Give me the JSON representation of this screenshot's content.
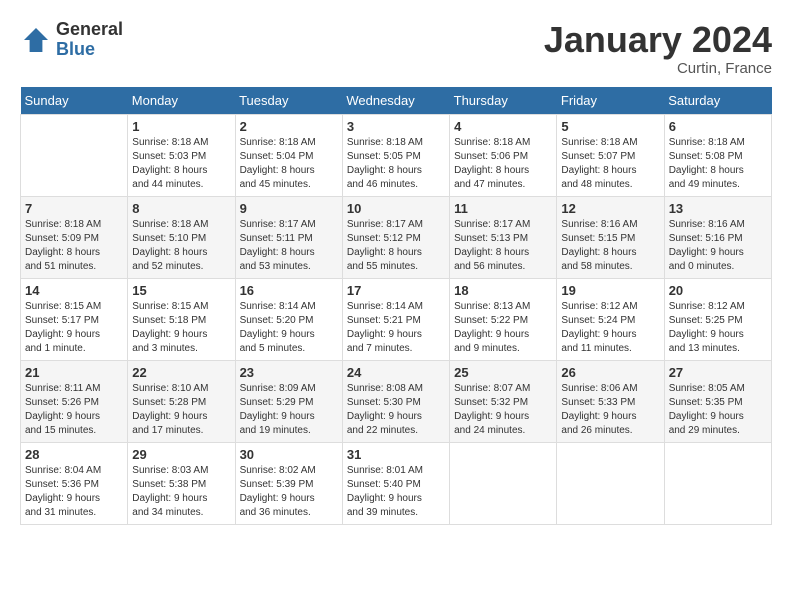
{
  "header": {
    "logo_general": "General",
    "logo_blue": "Blue",
    "month_title": "January 2024",
    "location": "Curtin, France"
  },
  "calendar": {
    "days_of_week": [
      "Sunday",
      "Monday",
      "Tuesday",
      "Wednesday",
      "Thursday",
      "Friday",
      "Saturday"
    ],
    "weeks": [
      [
        {
          "day": "",
          "info": ""
        },
        {
          "day": "1",
          "info": "Sunrise: 8:18 AM\nSunset: 5:03 PM\nDaylight: 8 hours\nand 44 minutes."
        },
        {
          "day": "2",
          "info": "Sunrise: 8:18 AM\nSunset: 5:04 PM\nDaylight: 8 hours\nand 45 minutes."
        },
        {
          "day": "3",
          "info": "Sunrise: 8:18 AM\nSunset: 5:05 PM\nDaylight: 8 hours\nand 46 minutes."
        },
        {
          "day": "4",
          "info": "Sunrise: 8:18 AM\nSunset: 5:06 PM\nDaylight: 8 hours\nand 47 minutes."
        },
        {
          "day": "5",
          "info": "Sunrise: 8:18 AM\nSunset: 5:07 PM\nDaylight: 8 hours\nand 48 minutes."
        },
        {
          "day": "6",
          "info": "Sunrise: 8:18 AM\nSunset: 5:08 PM\nDaylight: 8 hours\nand 49 minutes."
        }
      ],
      [
        {
          "day": "7",
          "info": "Sunrise: 8:18 AM\nSunset: 5:09 PM\nDaylight: 8 hours\nand 51 minutes."
        },
        {
          "day": "8",
          "info": "Sunrise: 8:18 AM\nSunset: 5:10 PM\nDaylight: 8 hours\nand 52 minutes."
        },
        {
          "day": "9",
          "info": "Sunrise: 8:17 AM\nSunset: 5:11 PM\nDaylight: 8 hours\nand 53 minutes."
        },
        {
          "day": "10",
          "info": "Sunrise: 8:17 AM\nSunset: 5:12 PM\nDaylight: 8 hours\nand 55 minutes."
        },
        {
          "day": "11",
          "info": "Sunrise: 8:17 AM\nSunset: 5:13 PM\nDaylight: 8 hours\nand 56 minutes."
        },
        {
          "day": "12",
          "info": "Sunrise: 8:16 AM\nSunset: 5:15 PM\nDaylight: 8 hours\nand 58 minutes."
        },
        {
          "day": "13",
          "info": "Sunrise: 8:16 AM\nSunset: 5:16 PM\nDaylight: 9 hours\nand 0 minutes."
        }
      ],
      [
        {
          "day": "14",
          "info": "Sunrise: 8:15 AM\nSunset: 5:17 PM\nDaylight: 9 hours\nand 1 minute."
        },
        {
          "day": "15",
          "info": "Sunrise: 8:15 AM\nSunset: 5:18 PM\nDaylight: 9 hours\nand 3 minutes."
        },
        {
          "day": "16",
          "info": "Sunrise: 8:14 AM\nSunset: 5:20 PM\nDaylight: 9 hours\nand 5 minutes."
        },
        {
          "day": "17",
          "info": "Sunrise: 8:14 AM\nSunset: 5:21 PM\nDaylight: 9 hours\nand 7 minutes."
        },
        {
          "day": "18",
          "info": "Sunrise: 8:13 AM\nSunset: 5:22 PM\nDaylight: 9 hours\nand 9 minutes."
        },
        {
          "day": "19",
          "info": "Sunrise: 8:12 AM\nSunset: 5:24 PM\nDaylight: 9 hours\nand 11 minutes."
        },
        {
          "day": "20",
          "info": "Sunrise: 8:12 AM\nSunset: 5:25 PM\nDaylight: 9 hours\nand 13 minutes."
        }
      ],
      [
        {
          "day": "21",
          "info": "Sunrise: 8:11 AM\nSunset: 5:26 PM\nDaylight: 9 hours\nand 15 minutes."
        },
        {
          "day": "22",
          "info": "Sunrise: 8:10 AM\nSunset: 5:28 PM\nDaylight: 9 hours\nand 17 minutes."
        },
        {
          "day": "23",
          "info": "Sunrise: 8:09 AM\nSunset: 5:29 PM\nDaylight: 9 hours\nand 19 minutes."
        },
        {
          "day": "24",
          "info": "Sunrise: 8:08 AM\nSunset: 5:30 PM\nDaylight: 9 hours\nand 22 minutes."
        },
        {
          "day": "25",
          "info": "Sunrise: 8:07 AM\nSunset: 5:32 PM\nDaylight: 9 hours\nand 24 minutes."
        },
        {
          "day": "26",
          "info": "Sunrise: 8:06 AM\nSunset: 5:33 PM\nDaylight: 9 hours\nand 26 minutes."
        },
        {
          "day": "27",
          "info": "Sunrise: 8:05 AM\nSunset: 5:35 PM\nDaylight: 9 hours\nand 29 minutes."
        }
      ],
      [
        {
          "day": "28",
          "info": "Sunrise: 8:04 AM\nSunset: 5:36 PM\nDaylight: 9 hours\nand 31 minutes."
        },
        {
          "day": "29",
          "info": "Sunrise: 8:03 AM\nSunset: 5:38 PM\nDaylight: 9 hours\nand 34 minutes."
        },
        {
          "day": "30",
          "info": "Sunrise: 8:02 AM\nSunset: 5:39 PM\nDaylight: 9 hours\nand 36 minutes."
        },
        {
          "day": "31",
          "info": "Sunrise: 8:01 AM\nSunset: 5:40 PM\nDaylight: 9 hours\nand 39 minutes."
        },
        {
          "day": "",
          "info": ""
        },
        {
          "day": "",
          "info": ""
        },
        {
          "day": "",
          "info": ""
        }
      ]
    ]
  }
}
